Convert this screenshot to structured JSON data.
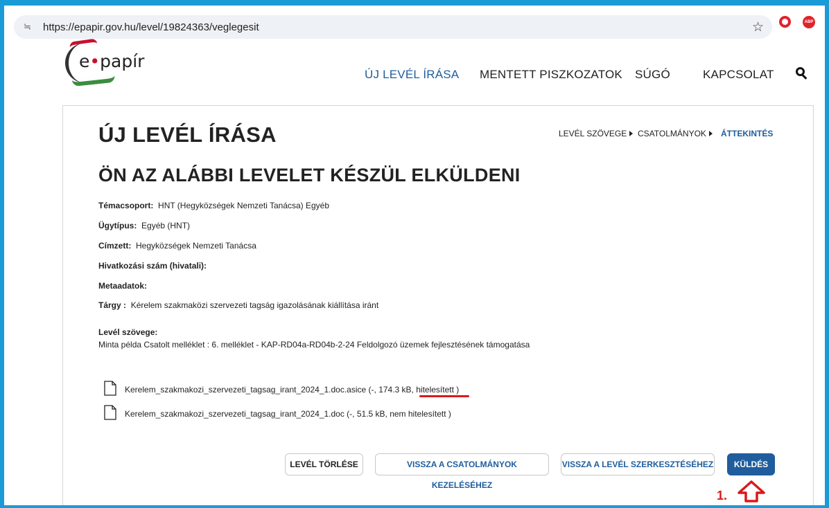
{
  "browser": {
    "url": "https://epapir.gov.hu/level/19824363/veglegesit",
    "site_icon": "≒",
    "star_icon": "☆",
    "abp_label": "ABP"
  },
  "logo": {
    "text_prefix": "e",
    "dot": "•",
    "text_suffix": "papír"
  },
  "nav": {
    "items": [
      "ÚJ LEVÉL ÍRÁSA",
      "MENTETT PISZKOZATOK",
      "SÚGÓ",
      "KAPCSOLAT"
    ],
    "active_color": "#1f5d9c"
  },
  "page": {
    "title": "ÚJ LEVÉL ÍRÁSA",
    "steps": [
      "LEVÉL SZÖVEGE",
      "CSATOLMÁNYOK",
      "ÁTTEKINTÉS"
    ],
    "section_title": "ÖN AZ ALÁBBI LEVELET KÉSZÜL ELKÜLDENI"
  },
  "fields": {
    "temacsoport_label": "Témacsoport:",
    "temacsoport_value": "HNT (Hegyközségek Nemzeti Tanácsa) Egyéb",
    "ugytipus_label": "Ügytípus:",
    "ugytipus_value": "Egyéb (HNT)",
    "cimzett_label": "Címzett:",
    "cimzett_value": "Hegyközségek Nemzeti Tanácsa",
    "hivatkozasi_label": "Hivatkozási szám (hivatali):",
    "metaadatok_label": "Metaadatok:",
    "targy_label": "Tárgy :",
    "targy_value": "Kérelem szakmaközi szervezeti tagság igazolásának kiállítása iránt",
    "level_szovege_label": "Levél szövege:",
    "level_szovege_value": "Minta példa Csatolt melléklet : 6. melléklet - KAP-RD04a-RD04b-2-24 Feldolgozó üzemek fejlesztésének támogatása"
  },
  "attachments": [
    {
      "name": "Kerelem_szakmakozi_szervezeti_tagsag_irant_2024_1.doc.asice (-, 174.3 kB, hitelesített )"
    },
    {
      "name": "Kerelem_szakmakozi_szervezeti_tagsag_irant_2024_1.doc (-, 51.5 kB, nem hitelesített )"
    }
  ],
  "buttons": {
    "delete": "LEVÉL TÖRLÉSE",
    "back_attachments": "VISSZA A CSATOLMÁNYOK KEZELÉSÉHEZ",
    "back_edit": "VISSZA A LEVÉL SZERKESZTÉSÉHEZ",
    "send": "KÜLDÉS"
  },
  "annotation": {
    "label": "1.",
    "color": "#d81a1a"
  }
}
